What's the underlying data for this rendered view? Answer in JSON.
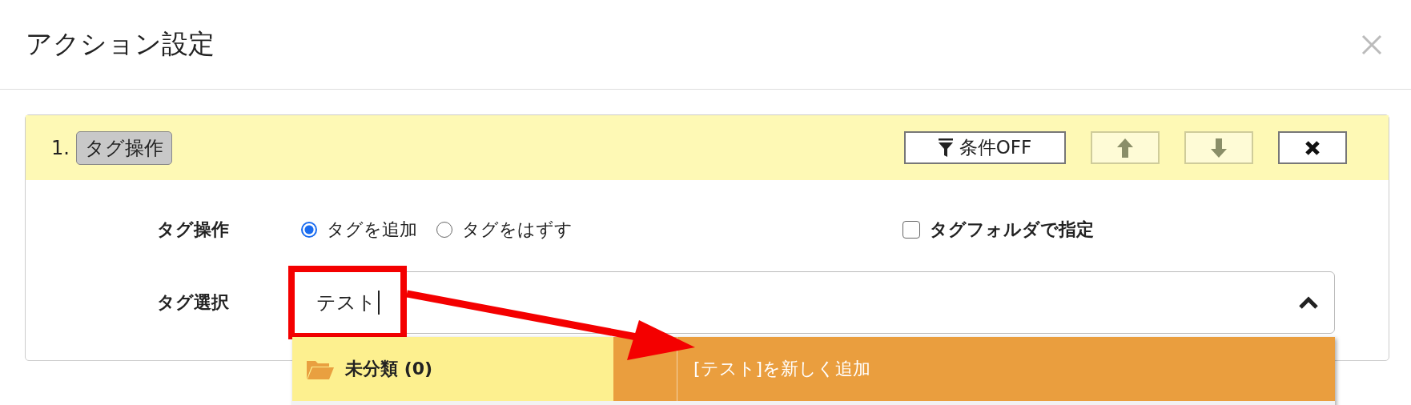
{
  "dialog": {
    "title": "アクション設定"
  },
  "action": {
    "number": "1.",
    "badge": "タグ操作",
    "buttons": [
      {
        "kind": "condition",
        "label": "条件OFF",
        "disabled": false
      },
      {
        "kind": "up",
        "disabled": true
      },
      {
        "kind": "down",
        "disabled": true
      },
      {
        "kind": "delete",
        "disabled": false
      }
    ],
    "tag_operation": {
      "label": "タグ操作",
      "options": [
        {
          "label": "タグを追加",
          "selected": true
        },
        {
          "label": "タグをはずす",
          "selected": false
        }
      ]
    },
    "folder_checkbox": {
      "label": "タグフォルダで指定",
      "checked": false
    },
    "tag_select": {
      "label": "タグ選択",
      "value": "テスト",
      "expanded": true,
      "folder": {
        "label": "未分類 (0)"
      },
      "option": {
        "label": "[テスト]を新しく追加",
        "highlighted": true
      }
    }
  }
}
